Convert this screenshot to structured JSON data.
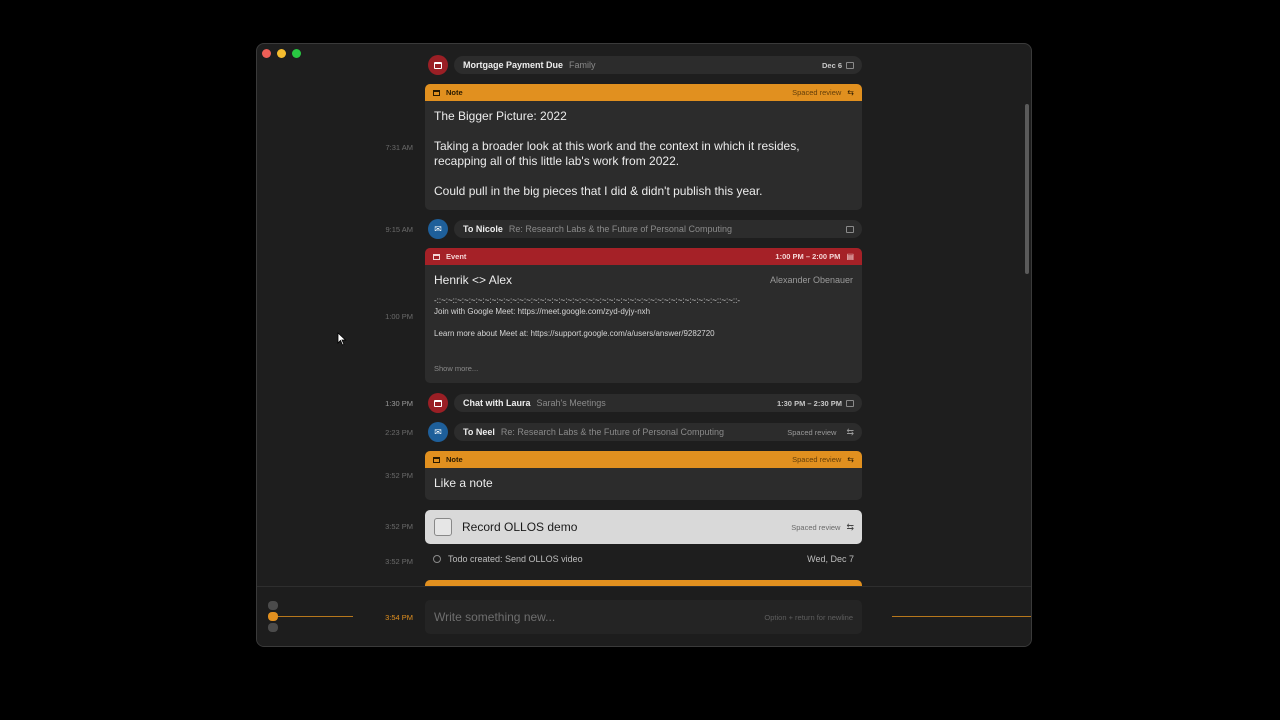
{
  "window": {
    "controls": [
      "close",
      "minimize",
      "zoom"
    ]
  },
  "timeline": {
    "item1": {
      "type": "event",
      "title": "Mortgage Payment Due",
      "subtitle": "Family",
      "right": "Dec 6"
    },
    "note1": {
      "time": "7:31 AM",
      "header": "Note",
      "right": "Spaced review",
      "title": "The Bigger Picture: 2022",
      "para1": "Taking a broader look at this work and the context in which it resides, recapping all of this little lab's work from 2022.",
      "para2": "Could pull in the big pieces that I did & didn't publish this year."
    },
    "email1": {
      "time": "9:15 AM",
      "title": "To Nicole",
      "subtitle": "Re: Research Labs & the Future of Personal Computing"
    },
    "event1": {
      "time": "1:00 PM",
      "header": "Event",
      "right": "1:00 PM – 2:00 PM",
      "title": "Henrik <> Alex",
      "organizer": "Alexander Obenauer",
      "divider": "-::~:~::~:~:~:~:~:~:~:~:~:~:~:~:~:~:~:~:~:~:~:~:~:~:~:~:~:~:~:~:~:~:~:~:~:~:~:~:~:~::~:~::-",
      "line1": "Join with Google Meet: https://meet.google.com/zyd-dyjy-nxh",
      "line2": "Learn more about Meet at: https://support.google.com/a/users/answer/9282720",
      "more": "Show more..."
    },
    "event2": {
      "time": "1:30 PM",
      "title": "Chat with Laura",
      "subtitle": "Sarah's Meetings",
      "right": "1:30 PM – 2:30 PM"
    },
    "email2": {
      "time": "2:23 PM",
      "title": "To Neel",
      "subtitle": "Re: Research Labs & the Future of Personal Computing",
      "right": "Spaced review"
    },
    "note2": {
      "time": "3:52 PM",
      "header": "Note",
      "right": "Spaced review",
      "title": "Like a note"
    },
    "todo1": {
      "time": "3:52 PM",
      "label": "Record OLLOS demo",
      "right": "Spaced review"
    },
    "activity1": {
      "time": "3:52 PM",
      "text": "Todo created: Send OLLOS video",
      "date": "Wed, Dec 7"
    }
  },
  "composer": {
    "time": "3:54 PM",
    "placeholder": "Write something new...",
    "hint": "Option + return for newline"
  },
  "colors": {
    "accent": "#e1901f",
    "event": "#a52127",
    "email": "#1e5f9a",
    "background": "#1e1e1e"
  }
}
